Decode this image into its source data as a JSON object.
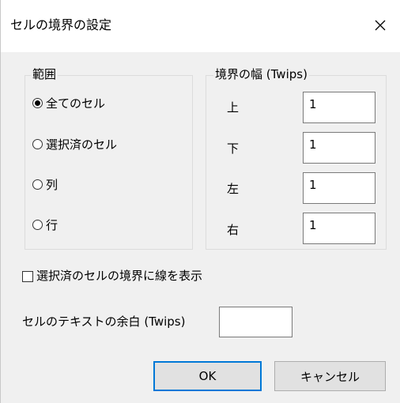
{
  "window": {
    "title": "セルの境界の設定"
  },
  "range_group": {
    "legend": "範囲",
    "options": [
      {
        "label": "全てのセル",
        "selected": true
      },
      {
        "label": "選択済のセル",
        "selected": false
      },
      {
        "label": "列",
        "selected": false
      },
      {
        "label": "行",
        "selected": false
      }
    ]
  },
  "width_group": {
    "legend": "境界の幅 (Twips)",
    "fields": [
      {
        "label": "上",
        "value": "1"
      },
      {
        "label": "下",
        "value": "1"
      },
      {
        "label": "左",
        "value": "1"
      },
      {
        "label": "右",
        "value": "1"
      }
    ]
  },
  "show_border_checkbox": {
    "label": "選択済のセルの境界に線を表示",
    "checked": false
  },
  "text_margin": {
    "label": "セルのテキストの余白 (Twips)",
    "value": ""
  },
  "buttons": {
    "ok": "OK",
    "cancel": "キャンセル"
  }
}
